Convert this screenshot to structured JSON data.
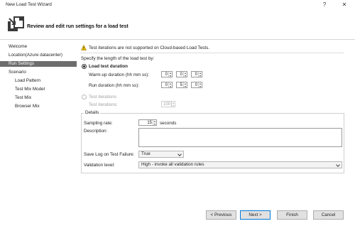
{
  "window": {
    "title": "New Load Test Wizard",
    "help_glyph": "?",
    "close_glyph": "✕"
  },
  "header": {
    "heading": "Review and edit run settings for a load test",
    "icon": "wizard-document-arrow-icon"
  },
  "nav": {
    "items": [
      {
        "label": "Welcome",
        "level": 0,
        "selected": false
      },
      {
        "label": "Location(Azure datacenter)",
        "level": 0,
        "selected": false
      },
      {
        "label": "Run Settings",
        "level": 0,
        "selected": true
      },
      {
        "label": "Scenario",
        "level": 0,
        "selected": false
      },
      {
        "label": "Load Pattern",
        "level": 1,
        "selected": false
      },
      {
        "label": "Test Mix Model",
        "level": 1,
        "selected": false
      },
      {
        "label": "Test Mix",
        "level": 1,
        "selected": false
      },
      {
        "label": "Browser Mix",
        "level": 1,
        "selected": false
      }
    ]
  },
  "content": {
    "warning_text": "Test iterations are not supported on Cloud-based Load Tests.",
    "warning_icon": "warning-icon",
    "length_prompt": "Specify the length of the load test by:",
    "duration_option": {
      "label": "Load test duration",
      "checked": true,
      "warmup_label": "Warm-up duration (hh mm ss):",
      "warmup": {
        "hh": "0",
        "mm": "0",
        "ss": "0"
      },
      "run_label": "Run duration (hh mm ss):",
      "run": {
        "hh": "0",
        "mm": "5",
        "ss": "0"
      }
    },
    "iterations_option": {
      "label": "Test iterations",
      "checked": false,
      "iterations_label": "Test iterations:",
      "iterations_value": "100"
    },
    "details": {
      "title": "Details",
      "sampling_label": "Sampling rate:",
      "sampling_value": "15",
      "sampling_unit": "seconds",
      "description_label": "Description:",
      "description_value": "",
      "save_log_label": "Save Log on Test Failure:",
      "save_log_value": "True",
      "validation_label": "Validation level:",
      "validation_value": "High - invoke all validation rules"
    }
  },
  "footer": {
    "previous": "< Previous",
    "next": "Next >",
    "finish": "Finish",
    "cancel": "Cancel"
  }
}
